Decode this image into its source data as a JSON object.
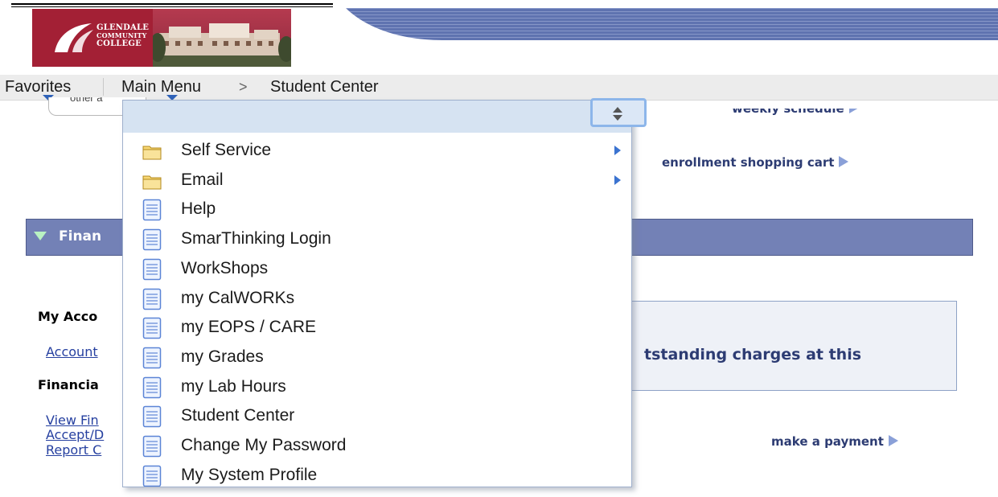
{
  "logo": {
    "line1": "GLENDALE",
    "line2": "COMMUNITY",
    "line3": "COLLEGE"
  },
  "nav": {
    "favorites": "Favorites",
    "main_menu": "Main Menu",
    "breadcrumb_sep": ">",
    "current": "Student Center"
  },
  "background": {
    "other_select": "other a",
    "weekly_schedule": "weekly schedule",
    "shopping_cart": "enrollment shopping cart",
    "finance_header": "Finan",
    "my_account": "My Acco",
    "account_link": "Account",
    "financial_aid": "Financia",
    "view_fin": "View Fin",
    "accept": "Accept/D",
    "report": "Report C",
    "charges_text": "tstanding charges at this",
    "make_payment": "make a payment"
  },
  "menu": {
    "items": [
      {
        "label": "Self Service",
        "icon": "folder-icon",
        "submenu": true
      },
      {
        "label": "Email",
        "icon": "folder-icon",
        "submenu": true
      },
      {
        "label": "Help",
        "icon": "document-icon",
        "submenu": false
      },
      {
        "label": "SmarThinking Login",
        "icon": "document-icon",
        "submenu": false
      },
      {
        "label": "WorkShops",
        "icon": "document-icon",
        "submenu": false
      },
      {
        "label": "my CalWORKs",
        "icon": "document-icon",
        "submenu": false
      },
      {
        "label": "my EOPS / CARE",
        "icon": "document-icon",
        "submenu": false
      },
      {
        "label": "my Grades",
        "icon": "document-icon",
        "submenu": false
      },
      {
        "label": "my Lab Hours",
        "icon": "document-icon",
        "submenu": false
      },
      {
        "label": "Student Center",
        "icon": "document-icon",
        "submenu": false
      },
      {
        "label": "Change My Password",
        "icon": "document-icon",
        "submenu": false
      },
      {
        "label": "My System Profile",
        "icon": "document-icon",
        "submenu": false
      }
    ]
  },
  "colors": {
    "brand": "#a32035",
    "finance_bar": "#7381b6",
    "link": "#2640a0",
    "menu_header": "#d6e3f2"
  }
}
